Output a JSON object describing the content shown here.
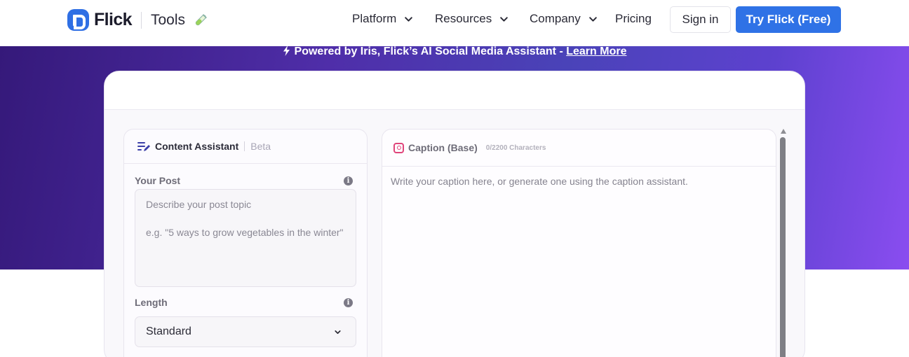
{
  "nav": {
    "brand": "Flick",
    "section": "Tools",
    "menu": [
      {
        "label": "Platform",
        "has_dropdown": true
      },
      {
        "label": "Resources",
        "has_dropdown": true
      },
      {
        "label": "Company",
        "has_dropdown": true
      },
      {
        "label": "Pricing",
        "has_dropdown": false
      }
    ],
    "sign_in": "Sign in",
    "cta": "Try Flick (Free)"
  },
  "hero": {
    "powered_text": "Powered by Iris, Flick’s AI Social Media Assistant - ",
    "learn_more": "Learn More"
  },
  "assistant": {
    "title": "Content Assistant",
    "badge": "Beta",
    "post_label": "Your Post",
    "post_placeholder": "Describe your post topic\n\ne.g. \"5 ways to grow vegetables in the winter\"",
    "length_label": "Length",
    "length_value": "Standard"
  },
  "caption": {
    "title": "Caption (Base)",
    "char_count": "0/2200 Characters",
    "placeholder": "Write your caption here, or generate one using the caption assistant."
  },
  "colors": {
    "brand_blue": "#2f72e6",
    "hero_start": "#35197a",
    "hero_end": "#8a4df0",
    "instagram": "#e0447a"
  }
}
